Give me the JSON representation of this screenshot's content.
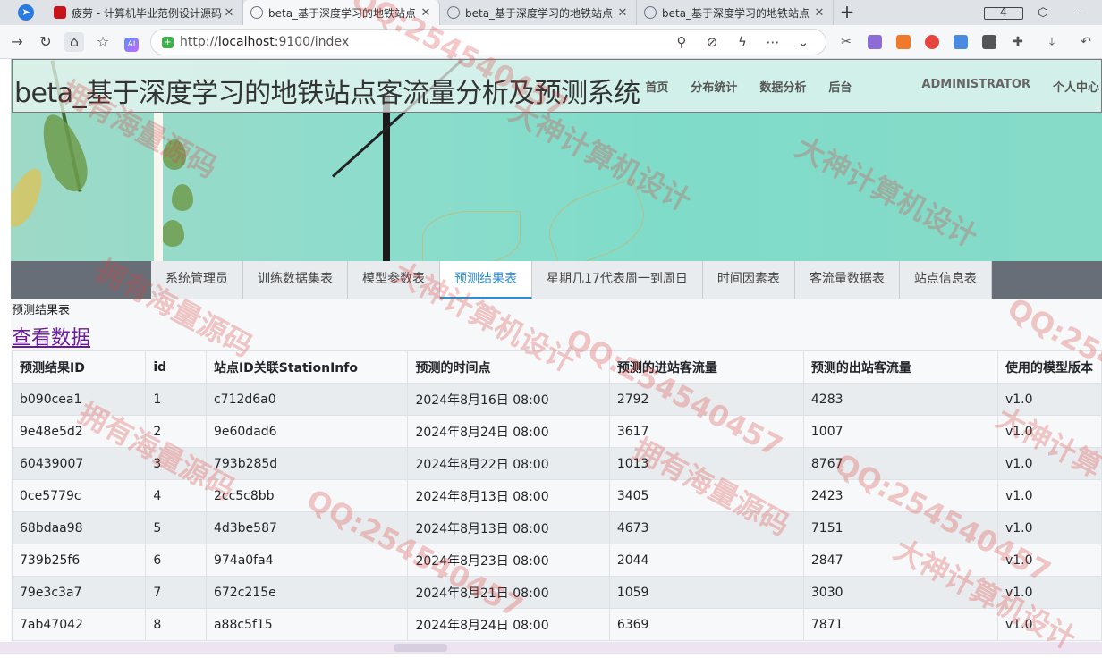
{
  "browser": {
    "tabs": [
      {
        "title": "疲劳 - 计算机毕业范例设计源码",
        "active": false,
        "icon": "red-square"
      },
      {
        "title": "beta_基于深度学习的地铁站点",
        "active": true,
        "icon": "globe"
      },
      {
        "title": "beta_基于深度学习的地铁站点",
        "active": false,
        "icon": "globe"
      },
      {
        "title": "beta_基于深度学习的地铁站点",
        "active": false,
        "icon": "globe"
      }
    ],
    "tab_count": "4",
    "url_prefix": "http://",
    "url_host": "localhost",
    "url_rest": ":9100/index"
  },
  "header": {
    "title": "beta_基于深度学习的地铁站点客流量分析及预测系统",
    "nav": [
      "首页",
      "分布统计",
      "数据分析",
      "后台"
    ],
    "admin_label": "ADMINISTRATOR",
    "profile_label": "个人中心"
  },
  "subnav": {
    "tabs": [
      "系统管理员",
      "训练数据集表",
      "模型参数表",
      "预测结果表",
      "星期几17代表周一到周日",
      "时间因素表",
      "客流量数据表",
      "站点信息表"
    ],
    "active_index": 3
  },
  "section_label": "预测结果表",
  "view_link": "查看数据",
  "table": {
    "columns": [
      "预测结果ID",
      "id",
      "站点ID关联StationInfo",
      "预测的时间点",
      "预测的进站客流量",
      "预测的出站客流量",
      "使用的模型版本"
    ],
    "rows": [
      [
        "b090cea1",
        "1",
        "c712d6a0",
        "2024年8月16日 08:00",
        "2792",
        "4283",
        "v1.0"
      ],
      [
        "9e48e5d2",
        "2",
        "9e60dad6",
        "2024年8月24日 08:00",
        "3617",
        "1007",
        "v1.0"
      ],
      [
        "60439007",
        "3",
        "793b285d",
        "2024年8月22日 08:00",
        "1013",
        "8767",
        "v1.0"
      ],
      [
        "0ce5779c",
        "4",
        "2cc5c8bb",
        "2024年8月13日 08:00",
        "3405",
        "2423",
        "v1.0"
      ],
      [
        "68bdaa98",
        "5",
        "4d3be587",
        "2024年8月13日 08:00",
        "4673",
        "7151",
        "v1.0"
      ],
      [
        "739b25f6",
        "6",
        "974a0fa4",
        "2024年8月23日 08:00",
        "2044",
        "2847",
        "v1.0"
      ],
      [
        "79e3c3a7",
        "7",
        "672c215e",
        "2024年8月21日 08:00",
        "1059",
        "3030",
        "v1.0"
      ],
      [
        "7ab47042",
        "8",
        "a88c5f15",
        "2024年8月24日 08:00",
        "6369",
        "7871",
        "v1.0"
      ]
    ]
  },
  "watermarks": [
    "大神计算机设计",
    "拥有海量源码",
    "QQ:254540457",
    "大神计算机设计",
    "拥有海量源码",
    "QQ:254540457",
    "大神计算机设计",
    "拥有海量源码",
    "QQ:254540457",
    "QQ:2545",
    "大神计算",
    "拥有海量源码",
    "QQ:254540457",
    "大神计算机设计"
  ],
  "colors": {
    "accent": "#2a8fd3",
    "link_visited": "#6a1b9a",
    "subnav_bg": "#686e77",
    "watermark": "#dc3c3c"
  }
}
